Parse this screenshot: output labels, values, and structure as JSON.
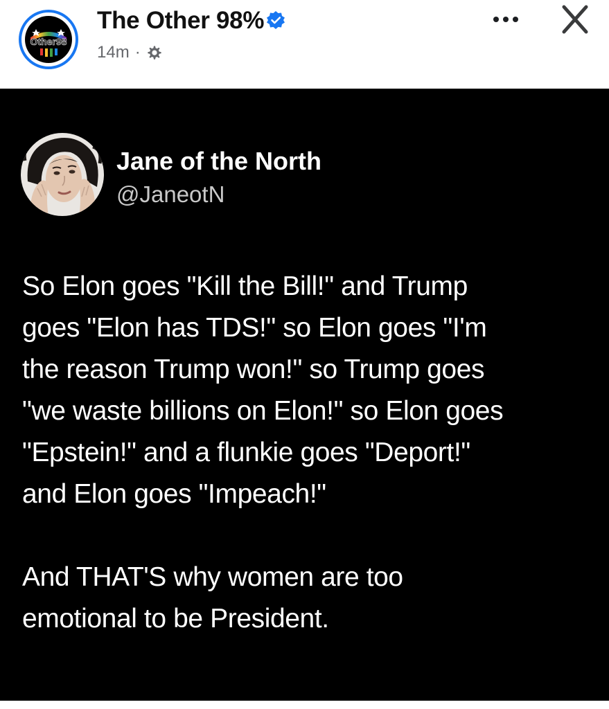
{
  "page": {
    "name": "The Other 98%",
    "avatar_text": "Other98",
    "timestamp": "14m",
    "meta_separator": "·",
    "audience_icon": "gear-icon",
    "verified_icon": "verified-badge-icon"
  },
  "actions": {
    "more_icon": "more-options-icon",
    "close_icon": "close-icon"
  },
  "tweet": {
    "author_name": "Jane of the North",
    "handle": "@JaneotN",
    "paragraphs": [
      "So Elon goes \"Kill the Bill!\" and Trump\ngoes \"Elon has TDS!\" so Elon goes \"I'm\nthe reason Trump won!\" so Trump goes\n\"we waste billions on Elon!\" so Elon goes\n\"Epstein!\" and a flunkie goes \"Deport!\"\nand Elon goes \"Impeach!\"",
      "And THAT'S why women are too\nemotional to be President."
    ]
  },
  "colors": {
    "verified_blue": "#1877f2",
    "image_background": "#000000",
    "meta_gray": "#65676b"
  }
}
